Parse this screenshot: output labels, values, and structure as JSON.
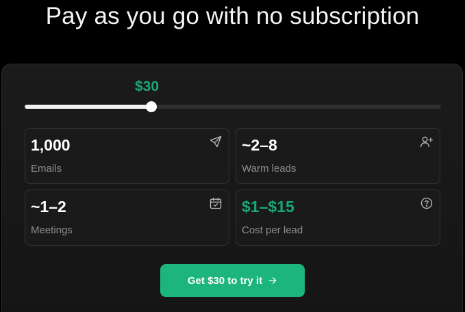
{
  "header": {
    "title": "Pay as you go with no subscription"
  },
  "pricing": {
    "slider": {
      "value_label": "$30",
      "fill_fraction": 0.305
    },
    "stats": [
      {
        "value": "1,000",
        "label": "Emails",
        "icon": "send-icon"
      },
      {
        "value": "~2–8",
        "label": "Warm leads",
        "icon": "add-user-icon"
      },
      {
        "value": "~1–2",
        "label": "Meetings",
        "icon": "calendar-check-icon"
      },
      {
        "value": "$1–$15",
        "label": "Cost per lead",
        "icon": "help-circle-icon"
      }
    ],
    "cta": {
      "label": "Get $30 to try it",
      "icon": "arrow-right-icon"
    }
  },
  "colors": {
    "background": "#000000",
    "card": "#171717",
    "accent_green": "#1aa774",
    "cta_green": "#1db57e",
    "muted_text": "#8e8e8e"
  }
}
